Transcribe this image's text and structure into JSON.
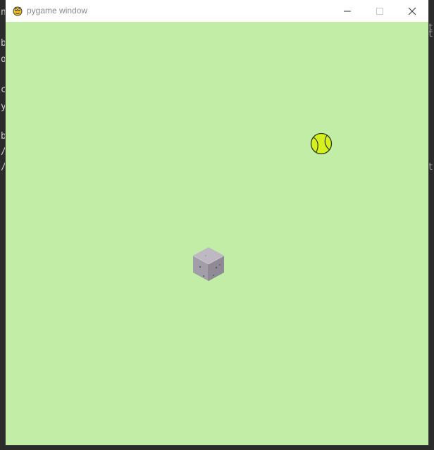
{
  "window": {
    "title": "pygame window",
    "icon": "pygame-snake-icon",
    "controls": {
      "minimize": "minimize-icon",
      "maximize": "maximize-icon",
      "close": "close-icon"
    },
    "canvas_color": "#c2eda6",
    "titlebar_color": "#ffffff"
  },
  "game": {
    "ball": {
      "icon": "tennis-ball-sprite",
      "color": "#d4f01e"
    },
    "obstacle": {
      "icon": "stone-block-sprite",
      "color": "#9e99a3"
    }
  },
  "background_terminal": {
    "left_chars": [
      "n",
      "b",
      "o",
      "c",
      "y",
      "b",
      "/",
      "/"
    ],
    "right_chars": [
      "t",
      "t",
      "t"
    ]
  }
}
